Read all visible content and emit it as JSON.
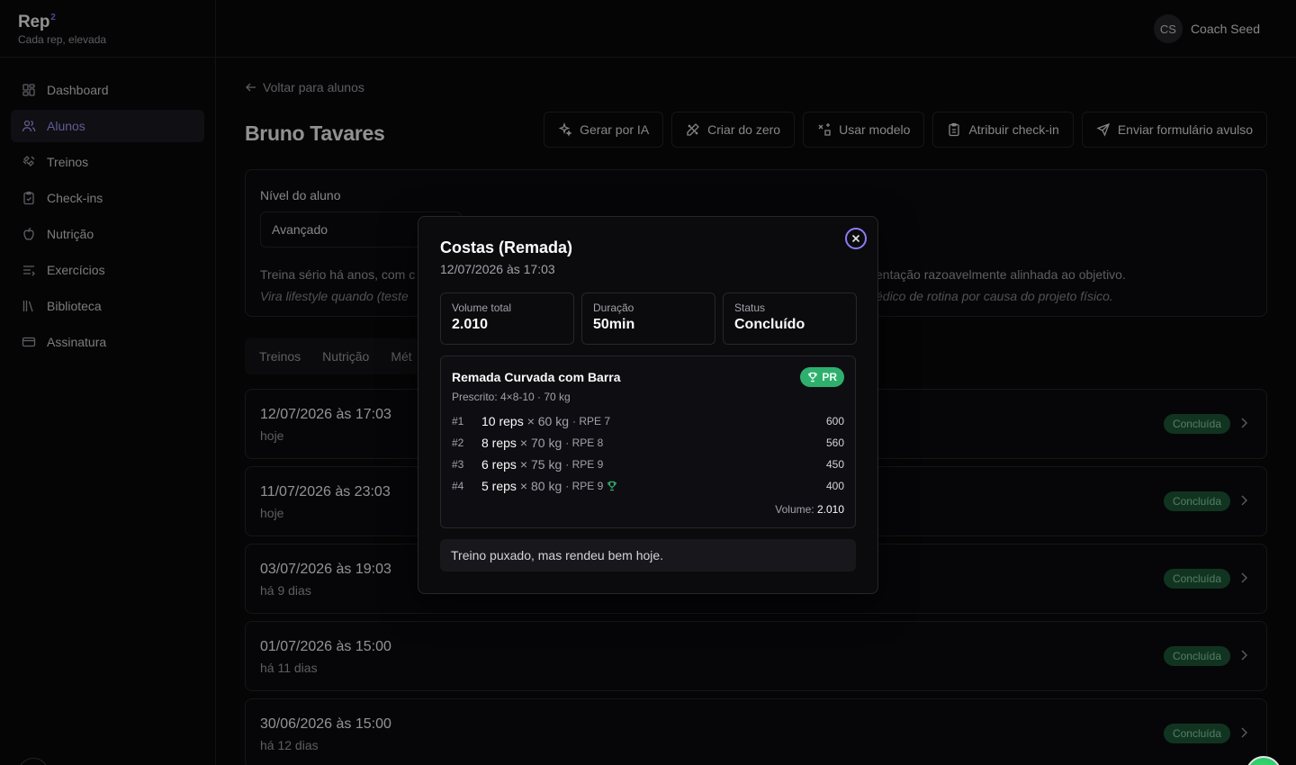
{
  "brand": {
    "name": "Rep",
    "sup": "2",
    "tagline": "Cada rep, elevada"
  },
  "user": {
    "initials": "CS",
    "name": "Coach Seed"
  },
  "nav": [
    {
      "label": "Dashboard",
      "icon": "dashboard-icon",
      "active": false
    },
    {
      "label": "Alunos",
      "icon": "users-icon",
      "active": true
    },
    {
      "label": "Treinos",
      "icon": "dumbbell-icon",
      "active": false
    },
    {
      "label": "Check-ins",
      "icon": "clipboard-check-icon",
      "active": false
    },
    {
      "label": "Nutrição",
      "icon": "apple-icon",
      "active": false
    },
    {
      "label": "Exercícios",
      "icon": "list-icon",
      "active": false
    },
    {
      "label": "Biblioteca",
      "icon": "library-icon",
      "active": false
    },
    {
      "label": "Assinatura",
      "icon": "credit-card-icon",
      "active": false
    }
  ],
  "page": {
    "back": "Voltar para alunos",
    "title": "Bruno Tavares",
    "actions": [
      {
        "label": "Gerar por IA",
        "icon": "sparkles-icon"
      },
      {
        "label": "Criar do zero",
        "icon": "pencil-ruler-icon"
      },
      {
        "label": "Usar modelo",
        "icon": "template-icon"
      },
      {
        "label": "Atribuir check-in",
        "icon": "clipboard-icon"
      },
      {
        "label": "Enviar formulário avulso",
        "icon": "send-icon"
      }
    ],
    "level": {
      "label": "Nível do aluno",
      "value": "Avançado",
      "desc_left": "Treina sério há anos, com c",
      "desc_right": "entação razoavelmente alinhada ao objetivo.",
      "note_left": "Vira lifestyle quando (teste",
      "note_right": "édico de rotina por causa do projeto físico."
    },
    "tabs": [
      "Treinos",
      "Nutrição",
      "Mét"
    ],
    "sessions": [
      {
        "date": "12/07/2026 às 17:03",
        "rel": "hoje",
        "status": "Concluída"
      },
      {
        "date": "11/07/2026 às 23:03",
        "rel": "hoje",
        "status": "Concluída"
      },
      {
        "date": "03/07/2026 às 19:03",
        "rel": "há 9 dias",
        "status": "Concluída"
      },
      {
        "date": "01/07/2026 às 15:00",
        "rel": "há 11 dias",
        "status": "Concluída"
      },
      {
        "date": "30/06/2026 às 15:00",
        "rel": "há 12 dias",
        "status": "Concluída"
      }
    ]
  },
  "modal": {
    "title": "Costas (Remada)",
    "subtitle": "12/07/2026 às 17:03",
    "stats": [
      {
        "label": "Volume total",
        "value": "2.010"
      },
      {
        "label": "Duração",
        "value": "50min"
      },
      {
        "label": "Status",
        "value": "Concluído"
      }
    ],
    "exercise": {
      "name": "Remada Curvada com Barra",
      "prescribed": "Prescrito: 4×8-10 · 70 kg",
      "badge": "PR",
      "sets": [
        {
          "idx": "#1",
          "reps": "10 reps",
          "weight": "× 60 kg",
          "rpe": "· RPE 7",
          "volume": "600",
          "pr": false
        },
        {
          "idx": "#2",
          "reps": "8 reps",
          "weight": "× 70 kg",
          "rpe": "· RPE 8",
          "volume": "560",
          "pr": false
        },
        {
          "idx": "#3",
          "reps": "6 reps",
          "weight": "× 75 kg",
          "rpe": "· RPE 9",
          "volume": "450",
          "pr": false
        },
        {
          "idx": "#4",
          "reps": "5 reps",
          "weight": "× 80 kg",
          "rpe": "· RPE 9",
          "volume": "400",
          "pr": true
        }
      ],
      "total_label": "Volume:",
      "total_value": "2.010"
    },
    "notes": "Treino puxado, mas rendeu bem hoje."
  },
  "colors": {
    "accent": "#8b7cf6",
    "success": "#2faf6e",
    "badge_bg": "#1e5b3a"
  }
}
